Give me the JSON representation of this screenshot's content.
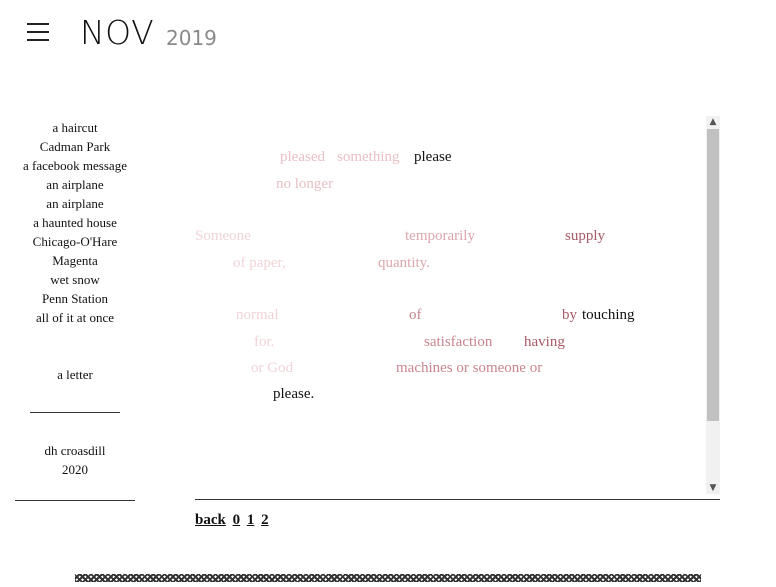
{
  "header": {
    "menu_icon": "hamburger-menu-icon",
    "month": "NOV",
    "year": "2019"
  },
  "sidebar": {
    "items": [
      "a haircut",
      "Cadman Park",
      "a facebook message",
      "an airplane",
      "an airplane",
      "a haunted house",
      "Chicago-O'Hare",
      "Magenta",
      "wet snow",
      "Penn Station",
      "all of it at once"
    ],
    "letter": "a letter",
    "author": "dh croasdill",
    "author_year": "2020"
  },
  "poem": {
    "words": [
      "pleased",
      "something",
      "please",
      "no longer",
      "Someone",
      "temporarily",
      "supply",
      "of paper,",
      "quantity.",
      "normal",
      "of",
      "by",
      "touching",
      "for.",
      "satisfaction",
      "having",
      "or God",
      "machines or someone or",
      "please."
    ]
  },
  "pagination": {
    "back": "back",
    "pages": [
      "0",
      "1",
      "2"
    ]
  },
  "colors": {
    "fade_lightest": "#f1d4d8",
    "fade_light": "#e8c0c6",
    "fade_mid": "#dba6ae",
    "fade_strong": "#c9858f",
    "fade_dark": "#a85a66",
    "text": "#111111"
  }
}
